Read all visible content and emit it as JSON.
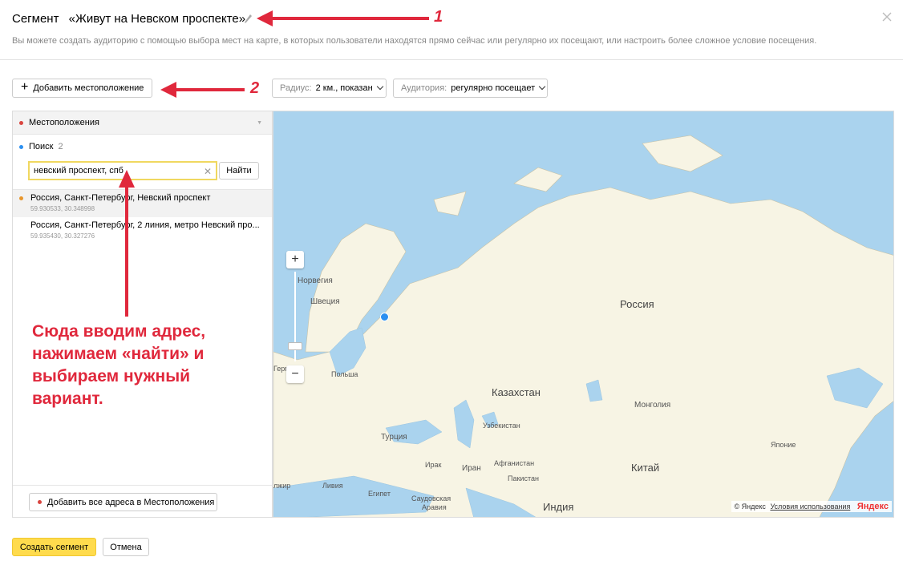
{
  "header": {
    "prefix": "Сегмент",
    "segment_name": "«Живут на Невском проспекте»",
    "subtitle": "Вы можете создать аудиторию с помощью выбора мест на карте, в которых пользователи находятся прямо сейчас или регулярно их посещают, или настроить более сложное условие посещения."
  },
  "toolbar": {
    "add_location_label": "Добавить местоположение",
    "radius_label": "Радиус:",
    "radius_value": "2 км., показан",
    "audience_label": "Аудитория:",
    "audience_value": "регулярно посещает"
  },
  "panel": {
    "locations_header": "Местоположения",
    "search_label": "Поиск",
    "search_count": "2",
    "search_value": "невский проспект, спб",
    "find_label": "Найти",
    "results": [
      {
        "title": "Россия, Санкт-Петербург, Невский проспект",
        "coords": "59.930533, 30.348998"
      },
      {
        "title": "Россия, Санкт-Петербург, 2 линия, метро Невский про...",
        "coords": "59.935430, 30.327276"
      }
    ],
    "add_all_label": "Добавить все адреса в Местоположения"
  },
  "map": {
    "labels": {
      "norway": "Норвегия",
      "sweden": "Швеция",
      "russia": "Россия",
      "poland": "Польша",
      "germany": "Герма",
      "kazakhstan": "Казахстан",
      "mongolia": "Монголия",
      "uzbekistan": "Узбекистан",
      "turkey": "Турция",
      "japan": "Японие",
      "iraq": "Ирак",
      "iran": "Иран",
      "afghanistan": "Афганистан",
      "china": "Китай",
      "pakistan": "Пакистан",
      "algeria": "лжир",
      "libya": "Ливия",
      "egypt": "Египет",
      "saudi": "Саудовская",
      "arabia": "Аравия",
      "india": "Индия"
    },
    "copyright": "© Яндекс",
    "terms": "Условия использования",
    "logo": "Яндекс"
  },
  "annotations": {
    "num1": "1",
    "num2": "2",
    "text": "Сюда вводим адрес,\nнажимаем «найти» и\nвыбираем нужный\nвариант."
  },
  "footer": {
    "create_label": "Создать сегмент",
    "cancel_label": "Отмена"
  },
  "colors": {
    "accent_yellow": "#ffdb4d",
    "annotation_red": "#e0283c",
    "sea": "#aad3ee",
    "land": "#f7f4e4",
    "pin_blue": "#2b8ff0"
  }
}
